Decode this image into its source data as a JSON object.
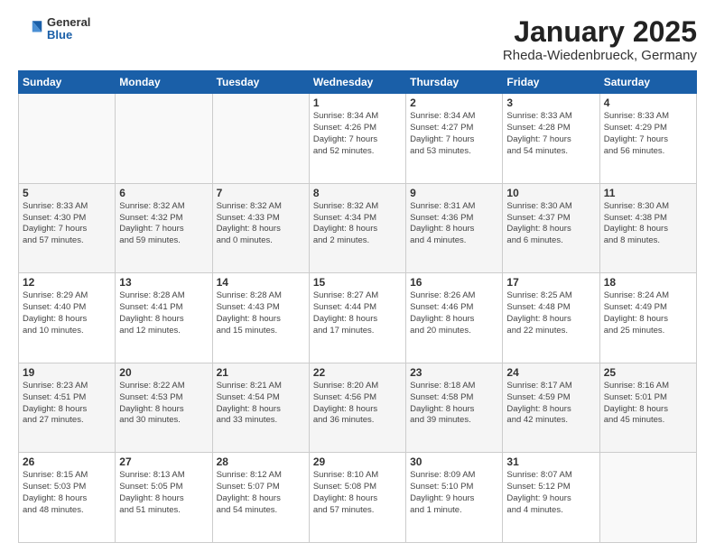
{
  "header": {
    "logo": {
      "general": "General",
      "blue": "Blue"
    },
    "title": "January 2025",
    "subtitle": "Rheda-Wiedenbrueck, Germany"
  },
  "weekdays": [
    "Sunday",
    "Monday",
    "Tuesday",
    "Wednesday",
    "Thursday",
    "Friday",
    "Saturday"
  ],
  "weeks": [
    [
      {
        "day": "",
        "info": ""
      },
      {
        "day": "",
        "info": ""
      },
      {
        "day": "",
        "info": ""
      },
      {
        "day": "1",
        "info": "Sunrise: 8:34 AM\nSunset: 4:26 PM\nDaylight: 7 hours\nand 52 minutes."
      },
      {
        "day": "2",
        "info": "Sunrise: 8:34 AM\nSunset: 4:27 PM\nDaylight: 7 hours\nand 53 minutes."
      },
      {
        "day": "3",
        "info": "Sunrise: 8:33 AM\nSunset: 4:28 PM\nDaylight: 7 hours\nand 54 minutes."
      },
      {
        "day": "4",
        "info": "Sunrise: 8:33 AM\nSunset: 4:29 PM\nDaylight: 7 hours\nand 56 minutes."
      }
    ],
    [
      {
        "day": "5",
        "info": "Sunrise: 8:33 AM\nSunset: 4:30 PM\nDaylight: 7 hours\nand 57 minutes."
      },
      {
        "day": "6",
        "info": "Sunrise: 8:32 AM\nSunset: 4:32 PM\nDaylight: 7 hours\nand 59 minutes."
      },
      {
        "day": "7",
        "info": "Sunrise: 8:32 AM\nSunset: 4:33 PM\nDaylight: 8 hours\nand 0 minutes."
      },
      {
        "day": "8",
        "info": "Sunrise: 8:32 AM\nSunset: 4:34 PM\nDaylight: 8 hours\nand 2 minutes."
      },
      {
        "day": "9",
        "info": "Sunrise: 8:31 AM\nSunset: 4:36 PM\nDaylight: 8 hours\nand 4 minutes."
      },
      {
        "day": "10",
        "info": "Sunrise: 8:30 AM\nSunset: 4:37 PM\nDaylight: 8 hours\nand 6 minutes."
      },
      {
        "day": "11",
        "info": "Sunrise: 8:30 AM\nSunset: 4:38 PM\nDaylight: 8 hours\nand 8 minutes."
      }
    ],
    [
      {
        "day": "12",
        "info": "Sunrise: 8:29 AM\nSunset: 4:40 PM\nDaylight: 8 hours\nand 10 minutes."
      },
      {
        "day": "13",
        "info": "Sunrise: 8:28 AM\nSunset: 4:41 PM\nDaylight: 8 hours\nand 12 minutes."
      },
      {
        "day": "14",
        "info": "Sunrise: 8:28 AM\nSunset: 4:43 PM\nDaylight: 8 hours\nand 15 minutes."
      },
      {
        "day": "15",
        "info": "Sunrise: 8:27 AM\nSunset: 4:44 PM\nDaylight: 8 hours\nand 17 minutes."
      },
      {
        "day": "16",
        "info": "Sunrise: 8:26 AM\nSunset: 4:46 PM\nDaylight: 8 hours\nand 20 minutes."
      },
      {
        "day": "17",
        "info": "Sunrise: 8:25 AM\nSunset: 4:48 PM\nDaylight: 8 hours\nand 22 minutes."
      },
      {
        "day": "18",
        "info": "Sunrise: 8:24 AM\nSunset: 4:49 PM\nDaylight: 8 hours\nand 25 minutes."
      }
    ],
    [
      {
        "day": "19",
        "info": "Sunrise: 8:23 AM\nSunset: 4:51 PM\nDaylight: 8 hours\nand 27 minutes."
      },
      {
        "day": "20",
        "info": "Sunrise: 8:22 AM\nSunset: 4:53 PM\nDaylight: 8 hours\nand 30 minutes."
      },
      {
        "day": "21",
        "info": "Sunrise: 8:21 AM\nSunset: 4:54 PM\nDaylight: 8 hours\nand 33 minutes."
      },
      {
        "day": "22",
        "info": "Sunrise: 8:20 AM\nSunset: 4:56 PM\nDaylight: 8 hours\nand 36 minutes."
      },
      {
        "day": "23",
        "info": "Sunrise: 8:18 AM\nSunset: 4:58 PM\nDaylight: 8 hours\nand 39 minutes."
      },
      {
        "day": "24",
        "info": "Sunrise: 8:17 AM\nSunset: 4:59 PM\nDaylight: 8 hours\nand 42 minutes."
      },
      {
        "day": "25",
        "info": "Sunrise: 8:16 AM\nSunset: 5:01 PM\nDaylight: 8 hours\nand 45 minutes."
      }
    ],
    [
      {
        "day": "26",
        "info": "Sunrise: 8:15 AM\nSunset: 5:03 PM\nDaylight: 8 hours\nand 48 minutes."
      },
      {
        "day": "27",
        "info": "Sunrise: 8:13 AM\nSunset: 5:05 PM\nDaylight: 8 hours\nand 51 minutes."
      },
      {
        "day": "28",
        "info": "Sunrise: 8:12 AM\nSunset: 5:07 PM\nDaylight: 8 hours\nand 54 minutes."
      },
      {
        "day": "29",
        "info": "Sunrise: 8:10 AM\nSunset: 5:08 PM\nDaylight: 8 hours\nand 57 minutes."
      },
      {
        "day": "30",
        "info": "Sunrise: 8:09 AM\nSunset: 5:10 PM\nDaylight: 9 hours\nand 1 minute."
      },
      {
        "day": "31",
        "info": "Sunrise: 8:07 AM\nSunset: 5:12 PM\nDaylight: 9 hours\nand 4 minutes."
      },
      {
        "day": "",
        "info": ""
      }
    ]
  ]
}
